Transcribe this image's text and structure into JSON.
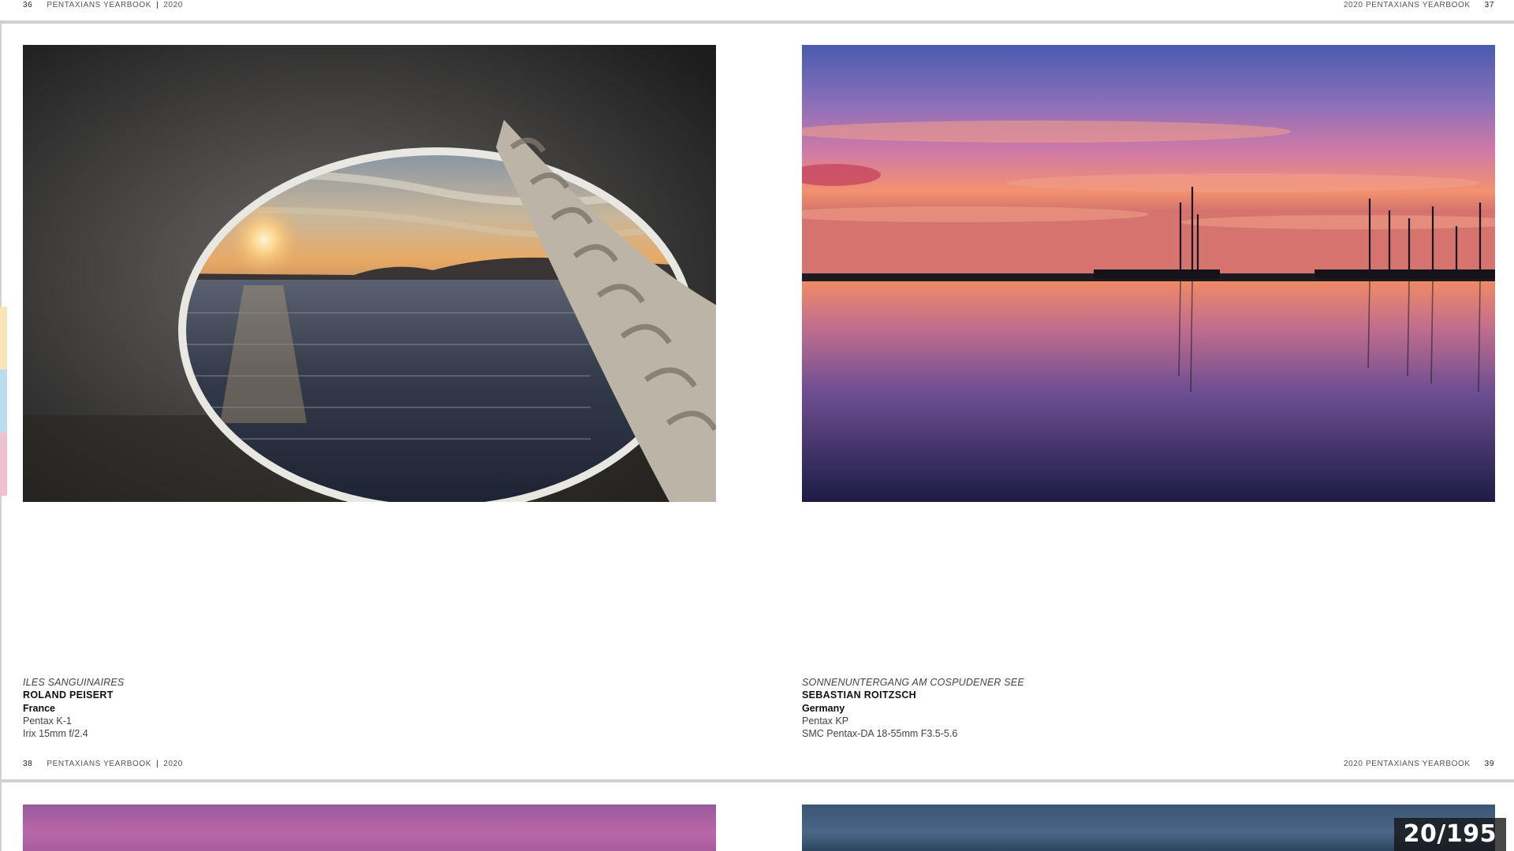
{
  "spreads": [
    {
      "left_header": {
        "page": "36",
        "book": "PENTAXIANS  YEARBOOK",
        "sep": "|",
        "year": "2020"
      },
      "right_header": {
        "year": "2020",
        "book": "PENTAXIANS  YEARBOOK",
        "page": "37"
      }
    },
    {
      "left_footer": {
        "page": "38",
        "book": "PENTAXIANS  YEARBOOK",
        "sep": "|",
        "year": "2020"
      },
      "right_footer": {
        "year": "2020",
        "book": "PENTAXIANS  YEARBOOK",
        "page": "39"
      }
    }
  ],
  "photos": [
    {
      "title": "ILES SANGUINAIRES",
      "author": "ROLAND PEISERT",
      "country": "France",
      "camera": "Pentax K-1",
      "lens": "Irix 15mm f/2.4"
    },
    {
      "title": "SONNENUNTERGANG AM COSPUDENER SEE",
      "author": "SEBASTIAN ROITZSCH",
      "country": "Germany",
      "camera": "Pentax KP",
      "lens": "SMC Pentax-DA 18-55mm F3.5-5.6"
    }
  ],
  "colors": {
    "tab_yellow": "#f7e7b8",
    "tab_blue": "#bcdbee",
    "tab_pink": "#f2bfd2",
    "divider": "#d0d0d0"
  },
  "viewer": {
    "counter": "20/195"
  }
}
